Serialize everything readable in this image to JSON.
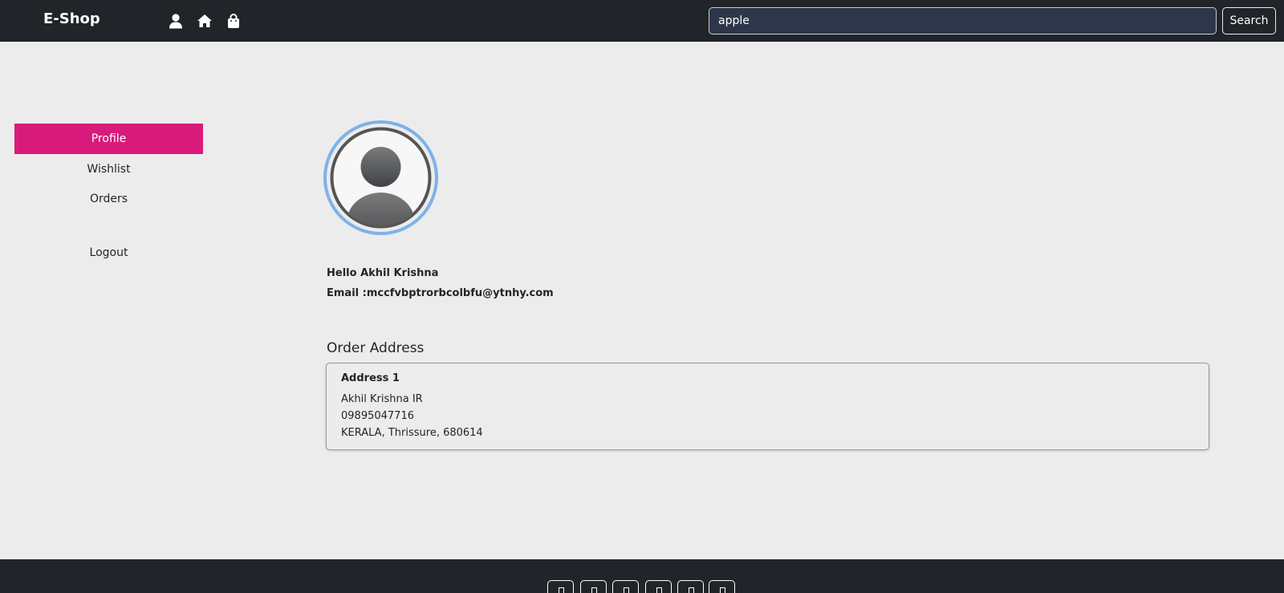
{
  "navbar": {
    "brand": "E-Shop",
    "icons": [
      "user-icon",
      "home-icon",
      "shopping-bag-icon"
    ],
    "search": {
      "value": "apple",
      "button_label": "Search"
    }
  },
  "sidebar": {
    "items": [
      {
        "label": "Profile",
        "active": true
      },
      {
        "label": "Wishlist",
        "active": false
      },
      {
        "label": "Orders",
        "active": false
      },
      {
        "label": "Logout",
        "active": false
      }
    ]
  },
  "profile": {
    "greeting": "Hello Akhil Krishna",
    "email_label": "Email :",
    "email": "mccfvbptrorbcolbfu@ytnhy.com"
  },
  "order_address": {
    "title": "Order Address",
    "addresses": [
      {
        "title": "Address 1",
        "name": "Akhil Krishna IR",
        "phone": "09895047716",
        "location": "KERALA, Thrissure, 680614"
      }
    ]
  },
  "footer": {
    "social_icons": [
      "social-icon-1",
      "social-icon-2",
      "social-icon-3",
      "social-icon-4",
      "social-icon-5",
      "social-icon-6"
    ]
  },
  "colors": {
    "navbar_bg": "#212529",
    "page_bg": "#ececec",
    "active_item": "#d81b7a",
    "avatar_ring": "#7db2e8",
    "search_bg": "#2e374a"
  }
}
